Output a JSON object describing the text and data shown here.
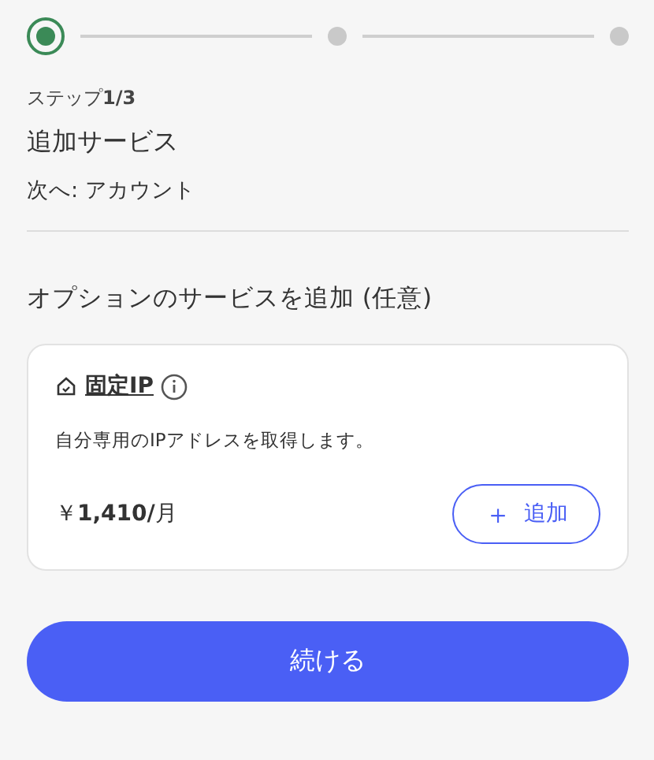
{
  "stepper": [
    {
      "selected": true
    },
    {
      "selected": false
    },
    {
      "selected": false
    }
  ],
  "step_label": "ステップ**1/3**",
  "title": "追加サービス",
  "next": "次へ: アカウント",
  "section_heading": "オプションのサービスを追加 (任意)",
  "services": [
    {
      "name": "固定IP",
      "description": "自分専用のIPアドレスを取得します。",
      "price": "￥**1,410/**月",
      "add_button": {
        "icon": "＋",
        "label": "追加"
      }
    }
  ],
  "continue_button": "続ける"
}
